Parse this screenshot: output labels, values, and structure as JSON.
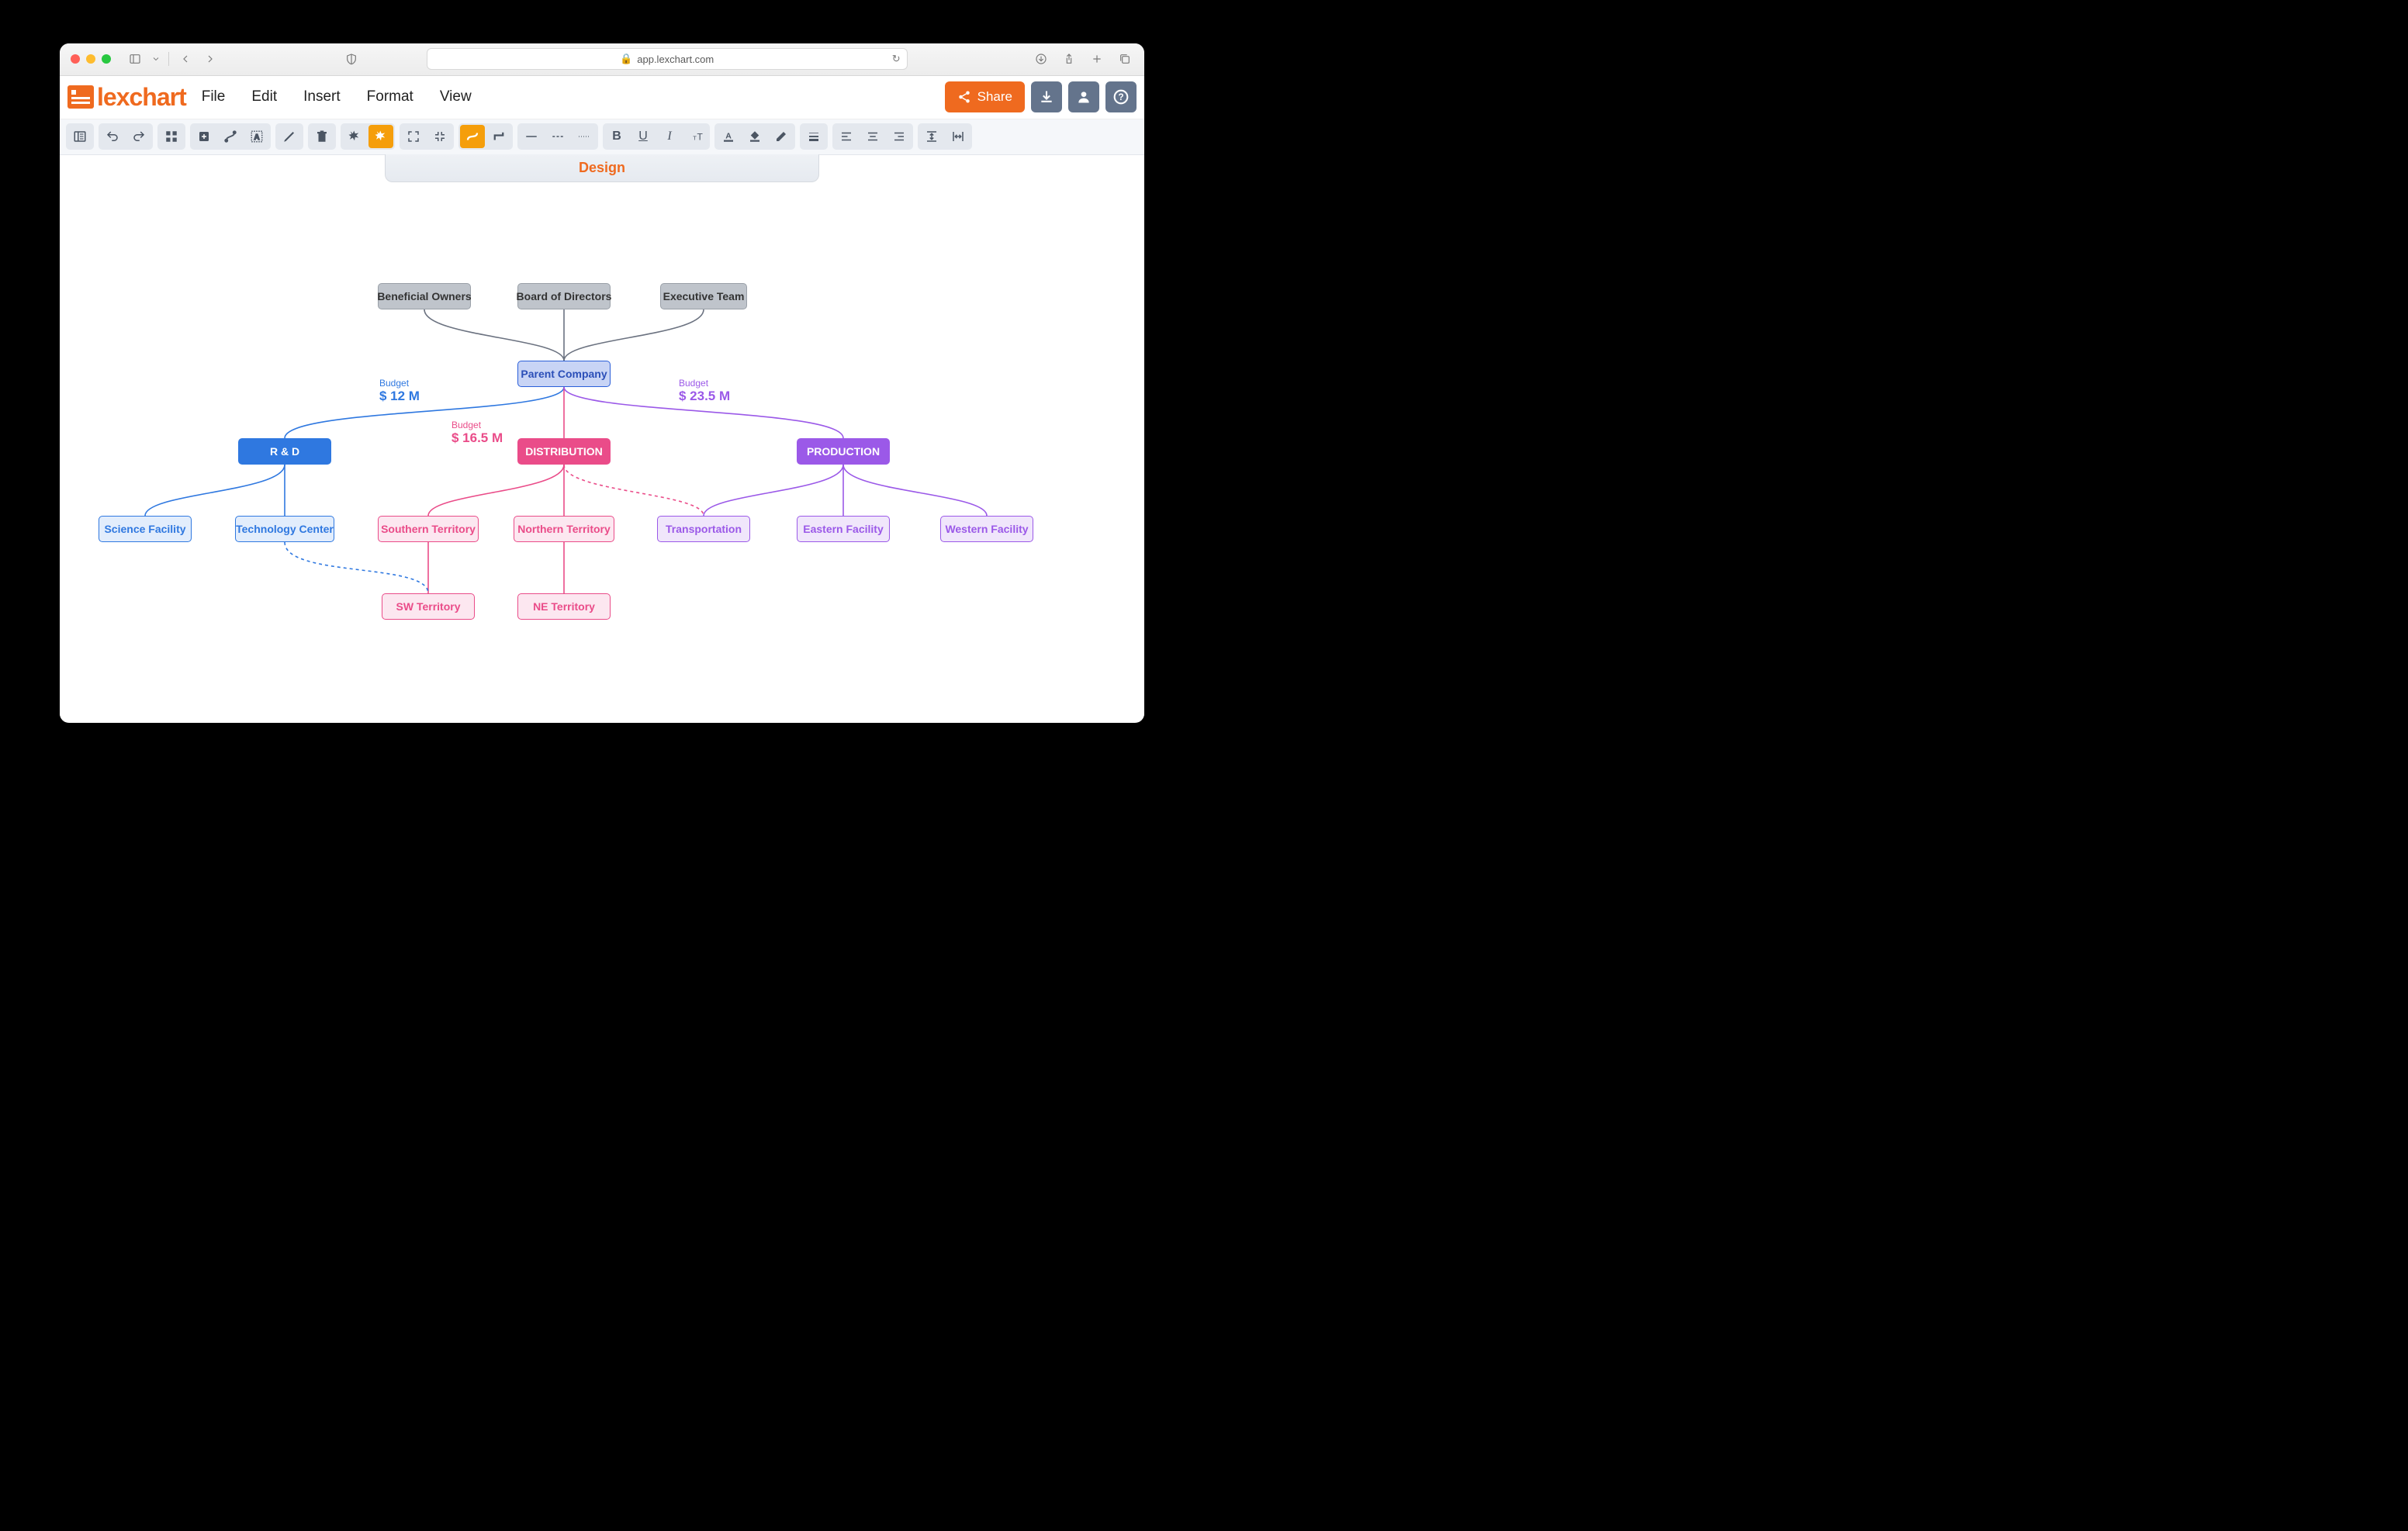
{
  "browser": {
    "url": "app.lexchart.com"
  },
  "logo_text": "lexchart",
  "menu": {
    "file": "File",
    "edit": "Edit",
    "insert": "Insert",
    "format": "Format",
    "view": "View"
  },
  "share_label": "Share",
  "tab_label": "Design",
  "budgets": {
    "rd": {
      "label": "Budget",
      "value": "$ 12 M"
    },
    "dist": {
      "label": "Budget",
      "value": "$ 16.5 M"
    },
    "prod": {
      "label": "Budget",
      "value": "$ 23.5 M"
    }
  },
  "nodes": {
    "owners": "Beneficial Owners",
    "board": "Board of Directors",
    "exec": "Executive Team",
    "parent": "Parent Company",
    "rd": "R & D",
    "dist": "DISTRIBUTION",
    "prod": "PRODUCTION",
    "science": "Science Facility",
    "tech": "Technology Center",
    "south": "Southern Territory",
    "north": "Northern Territory",
    "transport": "Transportation",
    "east": "Eastern Facility",
    "west": "Western Facility",
    "sw": "SW Territory",
    "ne": "NE Territory"
  },
  "colors": {
    "brand": "#ef6a1f",
    "blue": "#2f78e0",
    "pink": "#ea4c89",
    "purple": "#9b59e8",
    "gray": "#6b7280"
  },
  "chart_data": {
    "type": "org-chart",
    "title": "Design",
    "nodes": [
      {
        "id": "owners",
        "label": "Beneficial Owners",
        "style": "gray"
      },
      {
        "id": "board",
        "label": "Board of Directors",
        "style": "gray"
      },
      {
        "id": "exec",
        "label": "Executive Team",
        "style": "gray"
      },
      {
        "id": "parent",
        "label": "Parent Company",
        "style": "parent"
      },
      {
        "id": "rd",
        "label": "R & D",
        "style": "blue-solid",
        "budget": "$ 12 M"
      },
      {
        "id": "dist",
        "label": "DISTRIBUTION",
        "style": "pink-solid",
        "budget": "$ 16.5 M"
      },
      {
        "id": "prod",
        "label": "PRODUCTION",
        "style": "purple-solid",
        "budget": "$ 23.5 M"
      },
      {
        "id": "science",
        "label": "Science Facility",
        "style": "blue-out"
      },
      {
        "id": "tech",
        "label": "Technology Center",
        "style": "blue-out"
      },
      {
        "id": "south",
        "label": "Southern Territory",
        "style": "pink-out"
      },
      {
        "id": "north",
        "label": "Northern Territory",
        "style": "pink-out"
      },
      {
        "id": "transport",
        "label": "Transportation",
        "style": "purple-out"
      },
      {
        "id": "east",
        "label": "Eastern Facility",
        "style": "purple-out"
      },
      {
        "id": "west",
        "label": "Western Facility",
        "style": "purple-out"
      },
      {
        "id": "sw",
        "label": "SW Territory",
        "style": "pink-out"
      },
      {
        "id": "ne",
        "label": "NE Territory",
        "style": "pink-out"
      }
    ],
    "edges": [
      {
        "from": "owners",
        "to": "parent",
        "style": "gray"
      },
      {
        "from": "board",
        "to": "parent",
        "style": "gray"
      },
      {
        "from": "exec",
        "to": "parent",
        "style": "gray"
      },
      {
        "from": "parent",
        "to": "rd",
        "style": "blue"
      },
      {
        "from": "parent",
        "to": "dist",
        "style": "pink"
      },
      {
        "from": "parent",
        "to": "prod",
        "style": "purple"
      },
      {
        "from": "rd",
        "to": "science",
        "style": "blue"
      },
      {
        "from": "rd",
        "to": "tech",
        "style": "blue"
      },
      {
        "from": "dist",
        "to": "south",
        "style": "pink"
      },
      {
        "from": "dist",
        "to": "north",
        "style": "pink"
      },
      {
        "from": "dist",
        "to": "transport",
        "style": "pink",
        "dashed": true
      },
      {
        "from": "prod",
        "to": "transport",
        "style": "purple"
      },
      {
        "from": "prod",
        "to": "east",
        "style": "purple"
      },
      {
        "from": "prod",
        "to": "west",
        "style": "purple"
      },
      {
        "from": "south",
        "to": "sw",
        "style": "pink"
      },
      {
        "from": "north",
        "to": "ne",
        "style": "pink"
      },
      {
        "from": "tech",
        "to": "sw",
        "style": "blue",
        "dashed": true
      }
    ]
  }
}
